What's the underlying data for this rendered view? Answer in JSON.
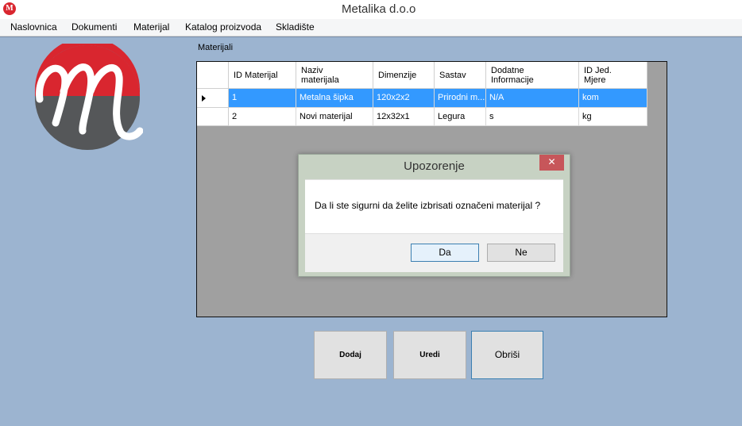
{
  "window": {
    "title": "Metalika d.o.o",
    "app_icon_glyph": "M"
  },
  "menu": {
    "items": [
      "Naslovnica",
      "Dokumenti",
      "Materijal",
      "Katalog proizvoda",
      "Skladište"
    ]
  },
  "group": {
    "label": "Materijali"
  },
  "table": {
    "columns": [
      "ID Materijal",
      "Naziv\nmaterijala",
      "Dimenzije",
      "Sastav",
      "Dodatne\nInformacije",
      "ID Jed.\nMjere"
    ],
    "rows": [
      [
        "1",
        "Metalna šipka",
        "120x2x2",
        "Prirodni m...",
        "N/A",
        "kom"
      ],
      [
        "2",
        "Novi materijal",
        "12x32x1",
        "Legura",
        "s",
        "kg"
      ]
    ],
    "selected_row_index": 0
  },
  "dialog": {
    "title": "Upozorenje",
    "message": "Da li ste sigurni da želite izbrisati označeni materijal ?",
    "close_glyph": "✕",
    "yes_label": "Da",
    "no_label": "Ne"
  },
  "actions": {
    "add_label": "Dodaj",
    "edit_label": "Uredi",
    "delete_label": "Obriši"
  },
  "colors": {
    "background": "#9cb4d0",
    "selection": "#3399ff",
    "logo_red": "#d9262f",
    "logo_gray": "#555759",
    "dialog_frame": "#c7d2c3",
    "close_button": "#c7565a"
  }
}
